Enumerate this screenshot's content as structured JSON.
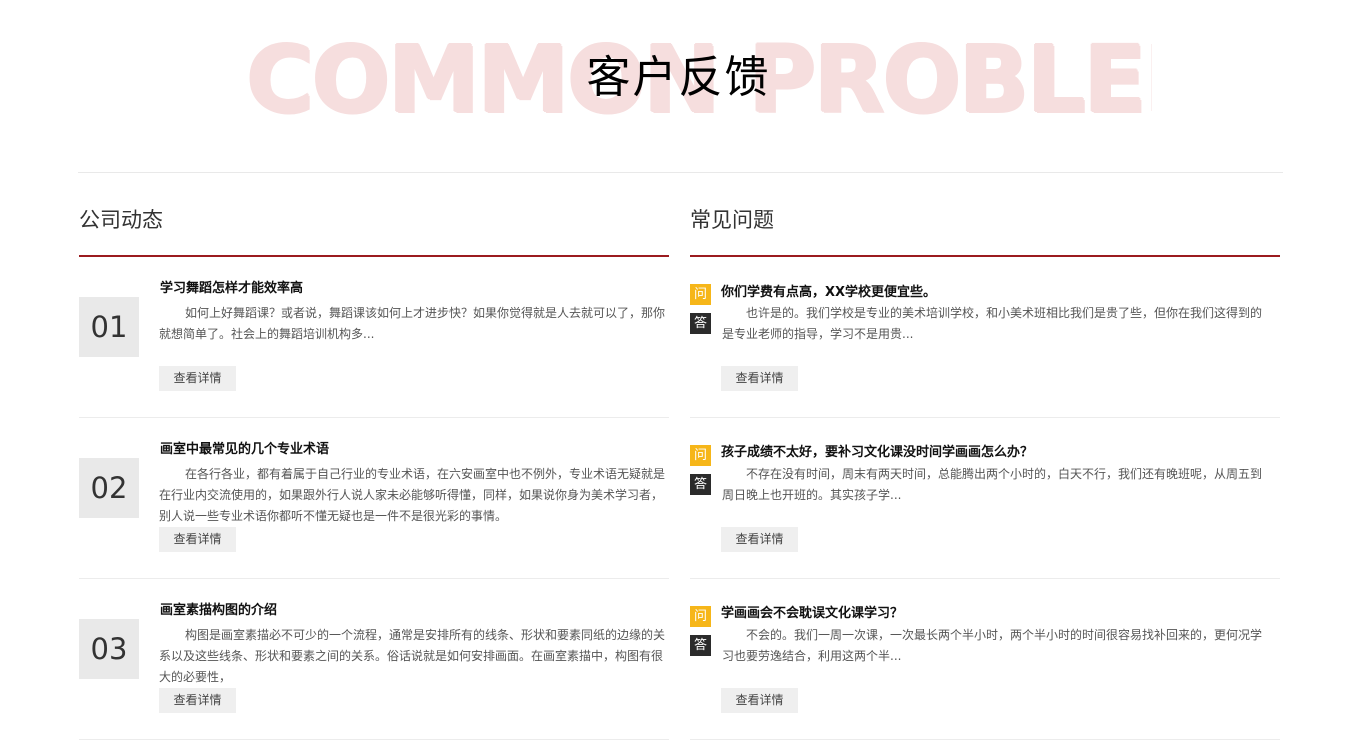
{
  "hero": {
    "background_text": "COMMON PROBLEMS",
    "title": "客户反馈"
  },
  "news": {
    "title": "公司动态",
    "items": [
      {
        "number": "01",
        "title": "学习舞蹈怎样才能效率高",
        "desc": "如何上好舞蹈课？或者说，舞蹈课该如何上才进步快？如果你觉得就是人去就可以了，那你就想简单了。社会上的舞蹈培训机构多...",
        "button": "查看详情"
      },
      {
        "number": "02",
        "title": "画室中最常见的几个专业术语",
        "desc": "在各行各业，都有着属于自己行业的专业术语，在六安画室中也不例外，专业术语无疑就是在行业内交流使用的，如果跟外行人说人家未必能够听得懂，同样，如果说你身为美术学习者，别人说一些专业术语你都听不懂无疑也是一件不是很光彩的事情。",
        "button": "查看详情"
      },
      {
        "number": "03",
        "title": "画室素描构图的介绍",
        "desc": "构图是画室素描必不可少的一个流程，通常是安排所有的线条、形状和要素同纸的边缘的关系以及这些线条、形状和要素之间的关系。俗话说就是如何安排画面。在画室素描中，构图有很大的必要性，",
        "button": "查看详情"
      }
    ]
  },
  "faq": {
    "title": "常见问题",
    "q_label": "问",
    "a_label": "答",
    "items": [
      {
        "question": "你们学费有点高，XX学校更便宜些。",
        "answer": "也许是的。我们学校是专业的美术培训学校，和小美术班相比我们是贵了些，但你在我们这得到的是专业老师的指导，学习不是用贵...",
        "button": "查看详情"
      },
      {
        "question": "孩子成绩不太好，要补习文化课没时间学画画怎么办？",
        "answer": "不存在没有时间，周末有两天时间，总能腾出两个小时的，白天不行，我们还有晚班呢，从周五到周日晚上也开班的。其实孩子学...",
        "button": "查看详情"
      },
      {
        "question": "学画画会不会耽误文化课学习？",
        "answer": "不会的。我们一周一次课，一次最长两个半小时，两个半小时的时间很容易找补回来的，更何况学习也要劳逸结合，利用这两个半...",
        "button": "查看详情"
      }
    ]
  },
  "colors": {
    "accent_rule": "#9b1b1f",
    "question_icon": "#f6b619",
    "answer_icon": "#2b2b2b",
    "hero_watermark": "#f6dede"
  }
}
